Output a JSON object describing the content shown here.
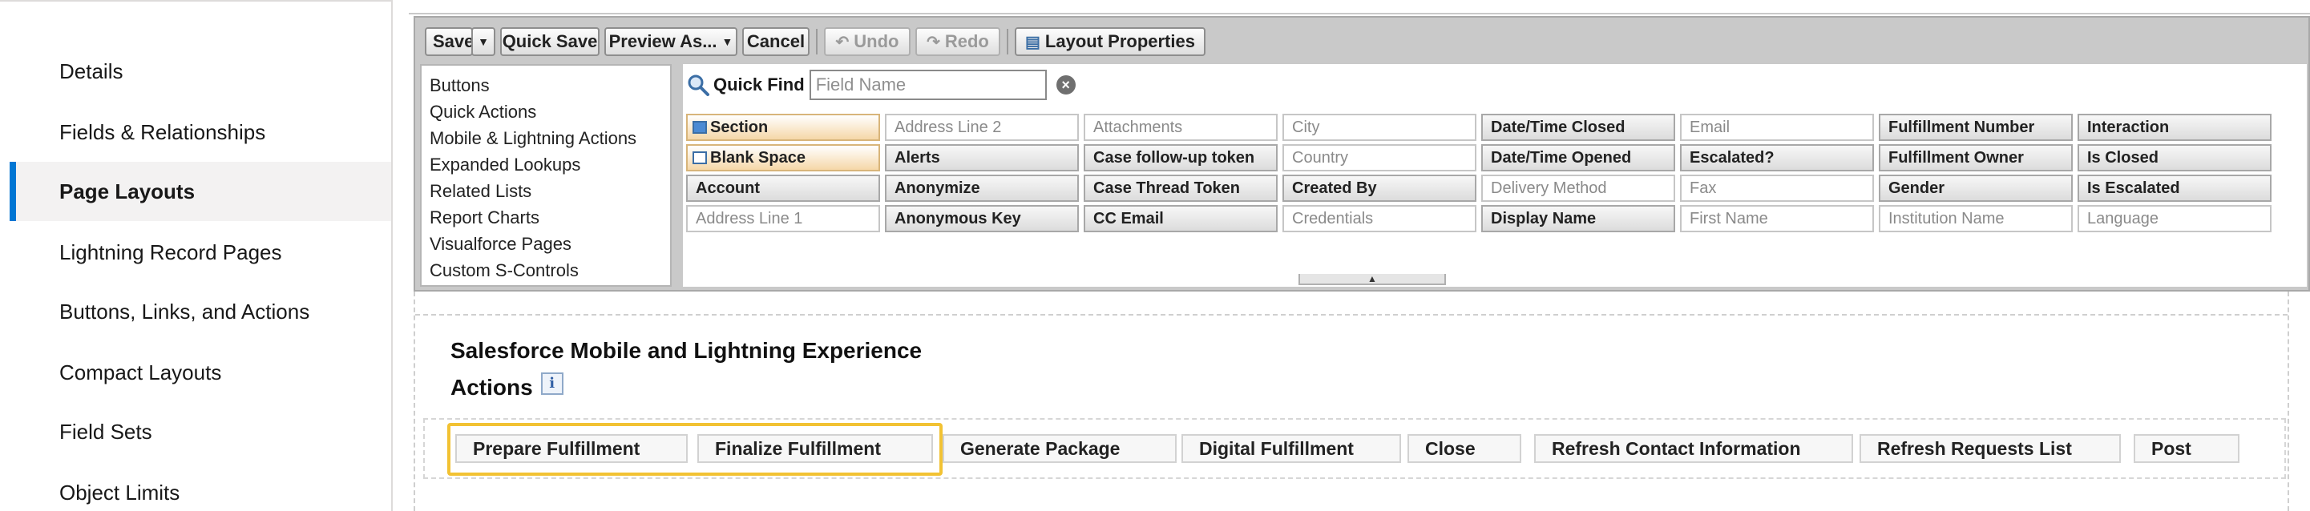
{
  "nav": {
    "items": [
      {
        "label": "Details",
        "active": false
      },
      {
        "label": "Fields & Relationships",
        "active": false
      },
      {
        "label": "Page Layouts",
        "active": true
      },
      {
        "label": "Lightning Record Pages",
        "active": false
      },
      {
        "label": "Buttons, Links, and Actions",
        "active": false
      },
      {
        "label": "Compact Layouts",
        "active": false
      },
      {
        "label": "Field Sets",
        "active": false
      },
      {
        "label": "Object Limits",
        "active": false
      }
    ]
  },
  "toolbar": {
    "save": "Save",
    "quick_save": "Quick Save",
    "preview_as": "Preview As...",
    "cancel": "Cancel",
    "undo": "Undo",
    "redo": "Redo",
    "layout_properties": "Layout Properties"
  },
  "palette": {
    "categories": [
      "Buttons",
      "Quick Actions",
      "Mobile & Lightning Actions",
      "Expanded Lookups",
      "Related Lists",
      "Report Charts",
      "Visualforce Pages",
      "Custom S-Controls"
    ],
    "quick_find": {
      "label": "Quick Find",
      "placeholder": "Field Name"
    },
    "fields": [
      [
        "Section",
        "Address Line 2",
        "Attachments",
        "City",
        "Date/Time Closed",
        "Email",
        "Fulfillment Number",
        "Interaction"
      ],
      [
        "Blank Space",
        "Alerts",
        "Case follow-up token",
        "Country",
        "Date/Time Opened",
        "Escalated?",
        "Fulfillment Owner",
        "Is Closed"
      ],
      [
        "Account",
        "Anonymize",
        "Case Thread Token",
        "Created By",
        "Delivery Method",
        "Fax",
        "Gender",
        "Is Escalated"
      ],
      [
        "Address Line 1",
        "Anonymous Key",
        "CC Email",
        "Credentials",
        "Display Name",
        "First Name",
        "Institution Name",
        "Language"
      ]
    ]
  },
  "layout": {
    "section_title": "Salesforce Mobile and Lightning Experience",
    "actions_title": "Actions",
    "info_glyph": "i",
    "actions": [
      "Prepare Fulfillment",
      "Finalize Fulfillment",
      "Generate Package",
      "Digital Fulfillment",
      "Close",
      "Refresh Contact Information",
      "Refresh Requests List",
      "Post"
    ]
  }
}
